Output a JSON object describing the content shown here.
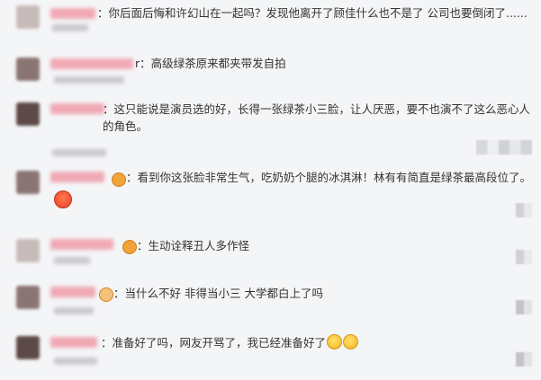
{
  "comments": [
    {
      "id": "c1",
      "prefix": "：",
      "text": "你后面后悔和许幻山在一起吗？发现他离开了顾佳什么也不是了 公司也要倒闭了......"
    },
    {
      "id": "c2",
      "prefix": "r：",
      "text": "高级绿茶原来都夹带发自拍"
    },
    {
      "id": "c3",
      "prefix": "：",
      "text": "这只能说是演员选的好，长得一张绿茶小三脸，让人厌恶，要不也演不了这么恶心人的角色。"
    },
    {
      "id": "c4",
      "prefix": "：",
      "text": "看到你这张脸非常生气，吃奶奶个腿的冰淇淋！林有有简直是绿茶最高段位了。"
    },
    {
      "id": "c5",
      "prefix": "：",
      "text": "生动诠释丑人多作怪"
    },
    {
      "id": "c6",
      "prefix": "：",
      "text": "当什么不好 非得当小三 大学都白上了吗"
    },
    {
      "id": "c7",
      "prefix": "：",
      "text": "准备好了吗，网友开骂了，我已经准备好了"
    }
  ],
  "icons": {
    "badge": "verified-badge-icon",
    "angry": "angry-face-icon",
    "laugh": "laughing-face-icon"
  }
}
